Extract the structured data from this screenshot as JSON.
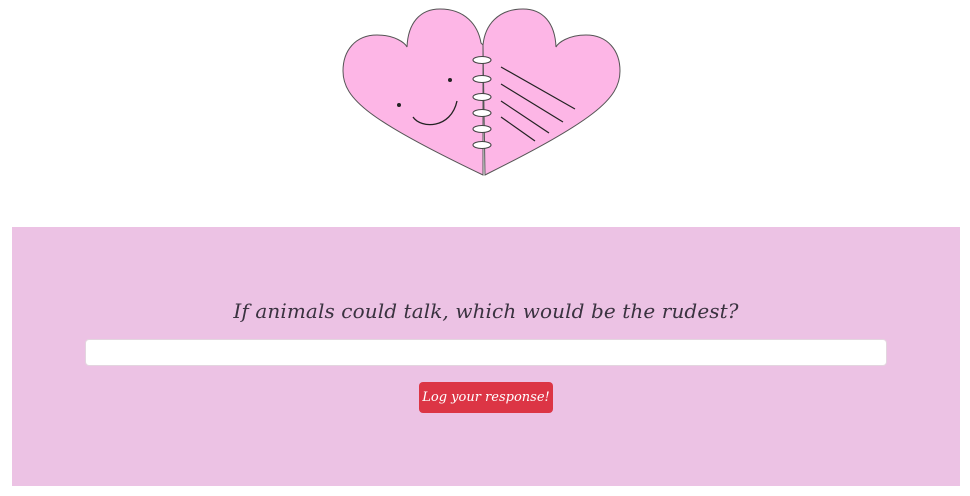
{
  "logo": {
    "icon": "heart-notebook-icon",
    "colors": {
      "fill": "#fdb6e6",
      "outline": "#555555",
      "ink": "#222222",
      "ring": "#ffffff"
    }
  },
  "prompt": {
    "question": "If animals could talk, which would be the rudest?"
  },
  "response": {
    "value": "",
    "placeholder": ""
  },
  "submit": {
    "label": "Log your response!"
  },
  "colors": {
    "panel_background": "#ecc2e4",
    "button_background": "#dc3545",
    "button_text": "#ffffff"
  }
}
